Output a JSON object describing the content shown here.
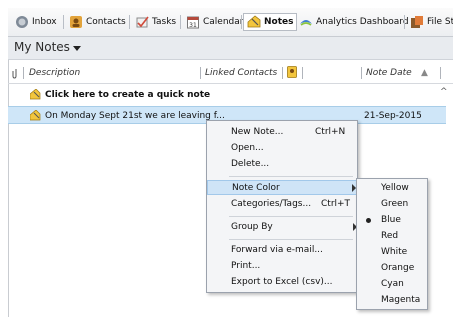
{
  "toolbar": {
    "items": [
      {
        "label": "Inbox",
        "icon": "inbox-icon"
      },
      {
        "label": "Contacts",
        "icon": "contacts-icon"
      },
      {
        "label": "Tasks",
        "icon": "tasks-icon"
      },
      {
        "label": "Calendar",
        "icon": "calendar-icon"
      },
      {
        "label": "Notes",
        "icon": "notes-icon",
        "active": true
      },
      {
        "label": "Analytics Dashboard",
        "icon": "analytics-icon"
      },
      {
        "label": "File Sto",
        "icon": "file-storage-icon"
      }
    ]
  },
  "header": {
    "title": "My Notes"
  },
  "columns": {
    "description": "Description",
    "linked_contacts": "Linked Contacts",
    "note_date": "Note Date"
  },
  "rows": [
    {
      "description": "Click here to create a quick note",
      "date": ""
    },
    {
      "description": "On Monday Sept 21st we are leaving f...",
      "date": "21-Sep-2015"
    }
  ],
  "context_menu": {
    "new_note": "New Note...",
    "new_note_shortcut": "Ctrl+N",
    "open": "Open...",
    "delete": "Delete...",
    "note_color": "Note Color",
    "categories": "Categories/Tags...",
    "categories_shortcut": "Ctrl+T",
    "group_by": "Group By",
    "forward": "Forward via e-mail...",
    "print": "Print...",
    "export": "Export to Excel (csv)..."
  },
  "color_submenu": {
    "options": [
      "Yellow",
      "Green",
      "Blue",
      "Red",
      "White",
      "Orange",
      "Cyan",
      "Magenta"
    ],
    "selected": "Blue"
  },
  "colors": {
    "accent": "#cfe6f8",
    "note_yellow": "#f2c53d"
  }
}
